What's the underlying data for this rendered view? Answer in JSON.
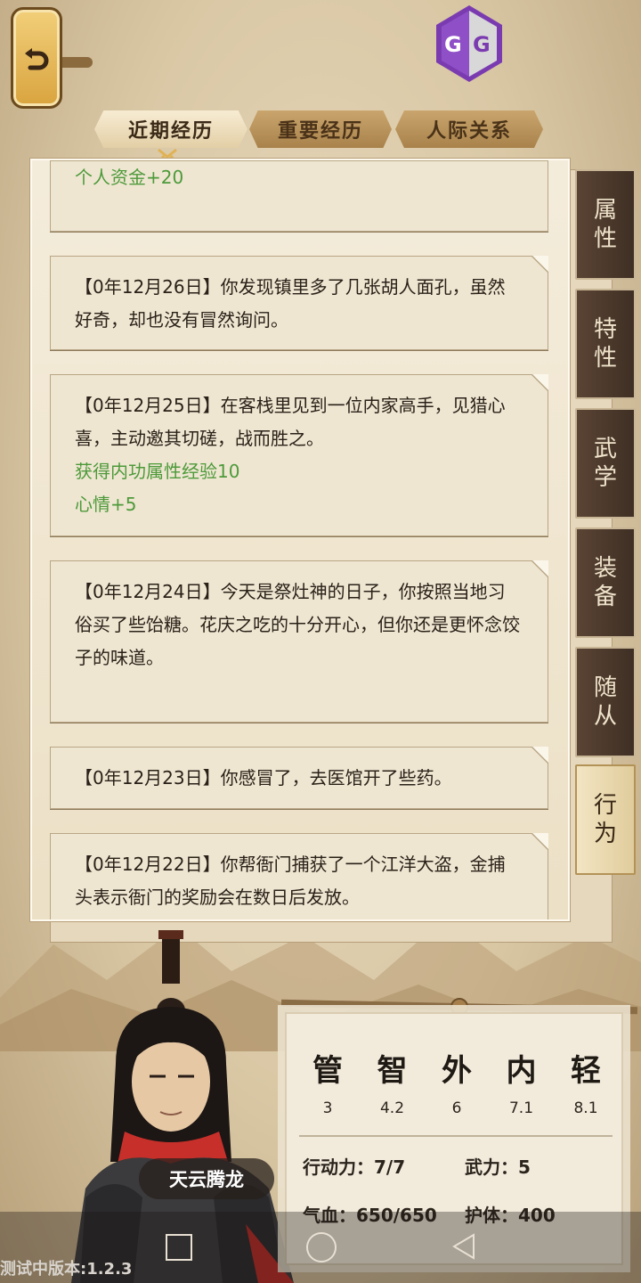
{
  "tabs": {
    "recent": "近期经历",
    "important": "重要经历",
    "relations": "人际关系"
  },
  "entries": {
    "e0": {
      "green1": "个人资金+20"
    },
    "e1": {
      "text": "【0年12月26日】你发现镇里多了几张胡人面孔，虽然好奇，却也没有冒然询问。"
    },
    "e2": {
      "text": "【0年12月25日】在客栈里见到一位内家高手，见猎心喜，主动邀其切磋，战而胜之。",
      "green1": "获得内功属性经验10",
      "green2": "心情+5"
    },
    "e3": {
      "text": "【0年12月24日】今天是祭灶神的日子，你按照当地习俗买了些饴糖。花庆之吃的十分开心，但你还是更怀念饺子的味道。"
    },
    "e4": {
      "text": "【0年12月23日】你感冒了，去医馆开了些药。"
    },
    "e5": {
      "text": "【0年12月22日】你帮衙门捕获了一个江洋大盗，金捕头表示衙门的奖励会在数日后发放。"
    }
  },
  "side_tabs": {
    "attributes": [
      "属",
      "性"
    ],
    "traits": [
      "特",
      "性"
    ],
    "martial": [
      "武",
      "学"
    ],
    "equipment": [
      "装",
      "备"
    ],
    "followers": [
      "随",
      "从"
    ],
    "actions": [
      "行",
      "为"
    ]
  },
  "character": {
    "name": "天云腾龙"
  },
  "stats": {
    "attrs": [
      {
        "label": "管",
        "value": "3"
      },
      {
        "label": "智",
        "value": "4.2"
      },
      {
        "label": "外",
        "value": "6"
      },
      {
        "label": "内",
        "value": "7.1"
      },
      {
        "label": "轻",
        "value": "8.1"
      }
    ],
    "action_points": "行动力：7/7",
    "force": "武力：5",
    "hp": "气血：650/650",
    "armor": "护体：400"
  },
  "version": "测试中版本:1.2.3",
  "colors": {
    "green": "#4d9a3a",
    "dark_tab": "#4a382b",
    "gold": "#e0b255"
  }
}
